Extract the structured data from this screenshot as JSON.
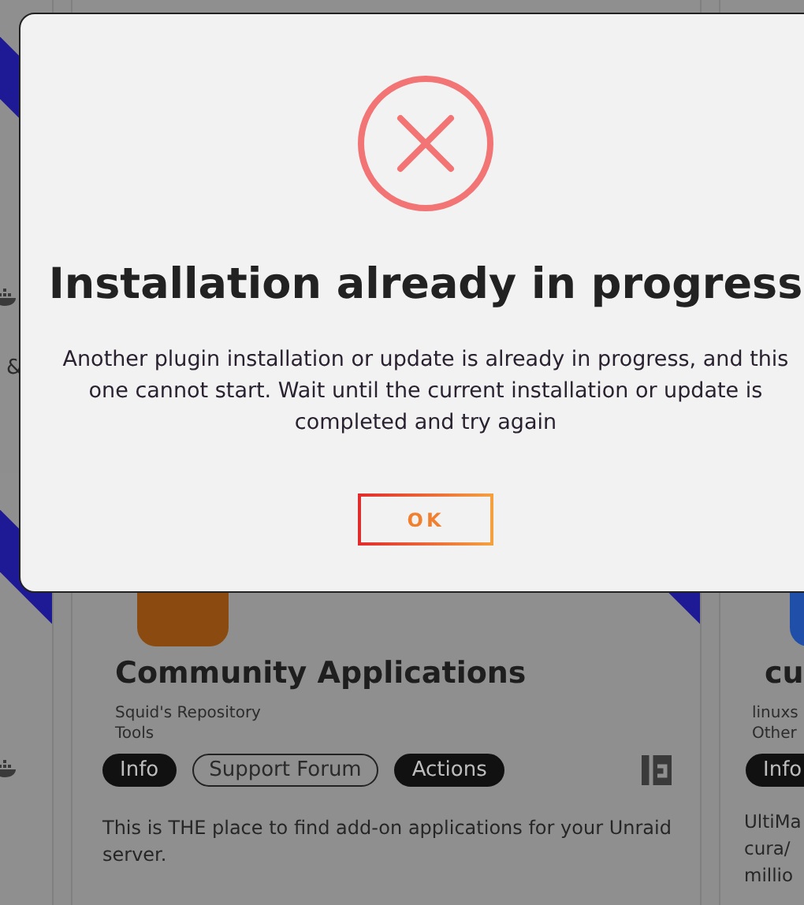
{
  "background": {
    "rows": [
      {
        "left": {
          "ribbon": true,
          "texts": [
            "&"
          ]
        },
        "center": null,
        "right": null
      },
      {
        "left": {
          "ribbon": true
        },
        "center": {
          "title": "Community Applications",
          "repository": "Squid's Repository",
          "category": "Tools",
          "buttons": [
            {
              "label": "Info",
              "kind": "filled"
            },
            {
              "label": "Support Forum",
              "kind": "outline"
            },
            {
              "label": "Actions",
              "kind": "filled"
            }
          ],
          "description": "This is THE place to find add-on applications for your Unraid server."
        },
        "right": {
          "title": "cu",
          "repository": "linuxs",
          "category": "Other",
          "buttons": [
            {
              "label": "Info",
              "kind": "filled"
            }
          ],
          "description_lines": [
            "UltiMa",
            "cura/",
            "millio"
          ]
        }
      }
    ]
  },
  "dialog": {
    "kind": "error",
    "title": "Installation already in progress",
    "message": "Another plugin installation or update is already in progress, and this one cannot start. Wait until the current installation or update is completed and try again",
    "buttons": [
      "OK"
    ]
  }
}
